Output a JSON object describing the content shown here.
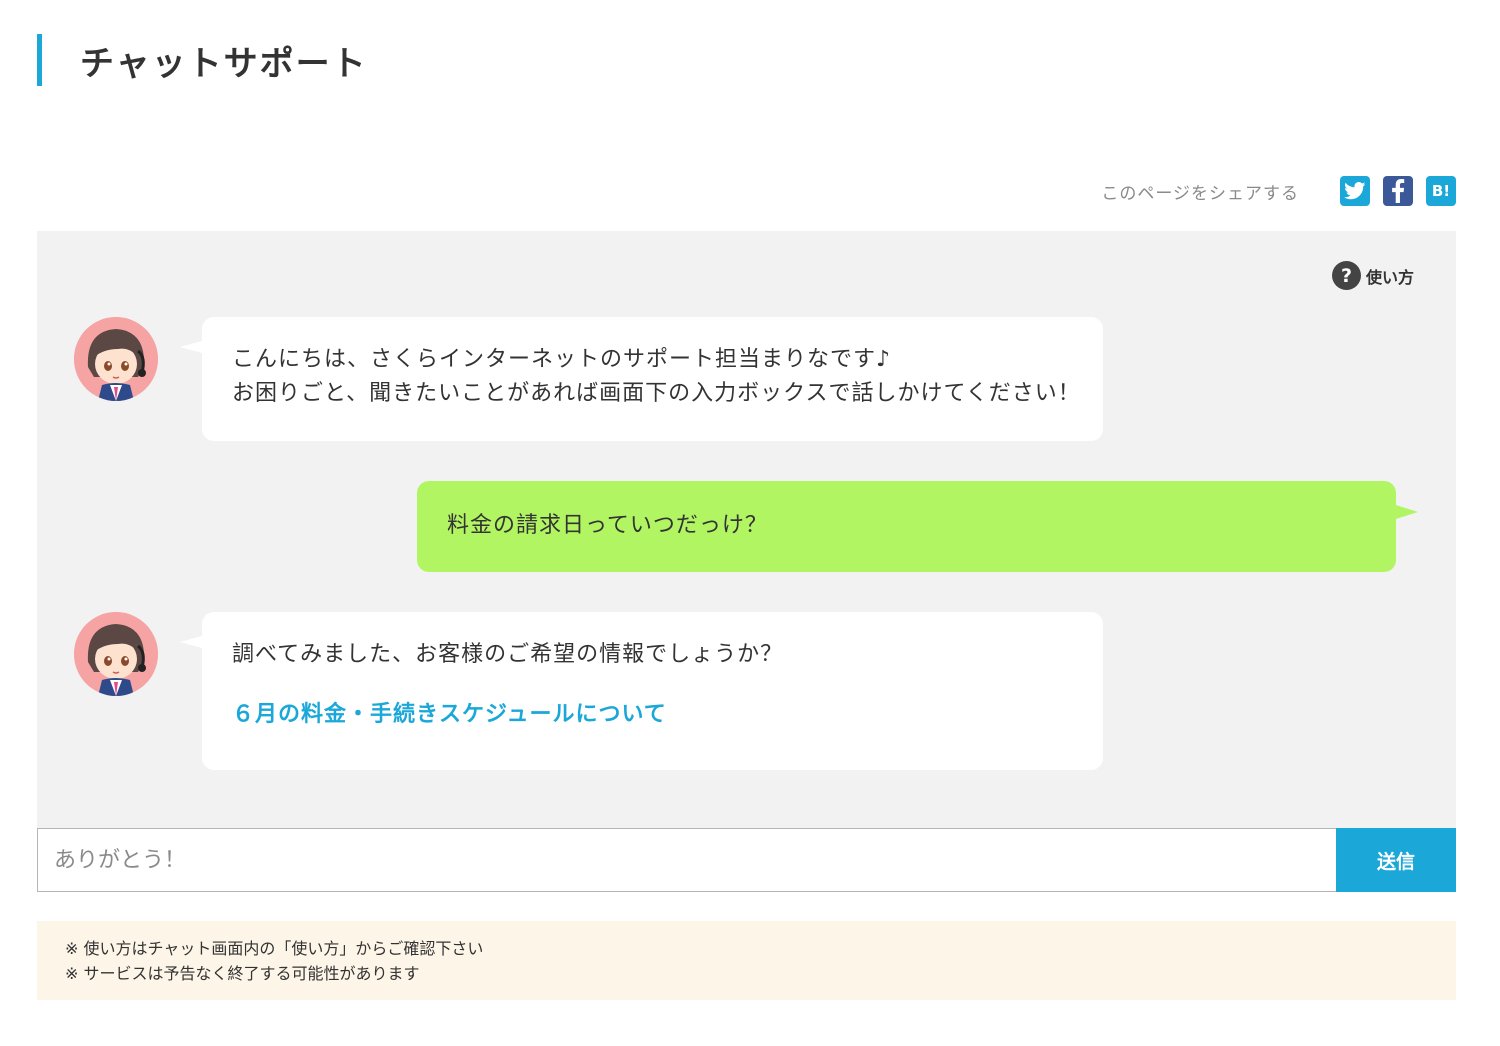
{
  "page": {
    "title": "チャットサポート"
  },
  "share": {
    "label": "このページをシェアする",
    "hatena_label": "B!"
  },
  "help": {
    "icon_glyph": "?",
    "label": "使い方"
  },
  "messages": [
    {
      "sender": "bot",
      "lines": [
        "こんにちは、さくらインターネットのサポート担当まりなです♪",
        "お困りごと、聞きたいことがあれば画面下の入力ボックスで話しかけてください！"
      ]
    },
    {
      "sender": "user",
      "text": "料金の請求日っていつだっけ？"
    },
    {
      "sender": "bot",
      "text": "調べてみました、お客様のご希望の情報でしょうか？",
      "link": "６月の料金・手続きスケジュールについて"
    }
  ],
  "input": {
    "placeholder": "ありがとう！",
    "send_label": "送信"
  },
  "notice": {
    "lines": [
      "※ 使い方はチャット画面内の「使い方」からご確認下さい",
      "※ サービスは予告なく終了する可能性があります"
    ]
  },
  "colors": {
    "accent": "#1ba8d9",
    "user_bubble": "#b2f563",
    "chat_background": "#f2f2f2",
    "notice_background": "#fdf5e8",
    "facebook": "#3b5998"
  },
  "icons": {
    "twitter": "twitter-icon",
    "facebook": "facebook-icon",
    "hatena": "hatena-bookmark-icon",
    "help": "question-circle-icon",
    "avatar": "operator-avatar"
  }
}
